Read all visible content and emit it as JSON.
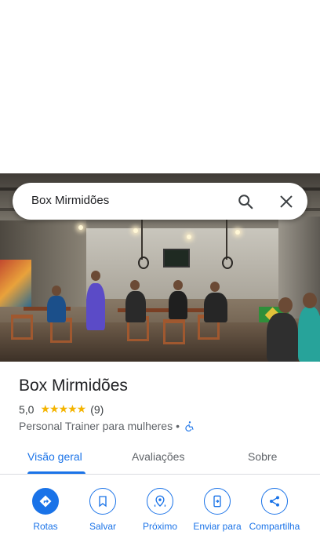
{
  "search": {
    "query": "Box Mirmidões"
  },
  "place": {
    "name": "Box Mirmidões",
    "rating": "5,0",
    "stars": "★★★★★",
    "review_count": "(9)",
    "category": "Personal Trainer para mulheres",
    "separator": "•"
  },
  "tabs": [
    {
      "label": "Visão geral",
      "active": true
    },
    {
      "label": "Avaliações",
      "active": false
    },
    {
      "label": "Sobre",
      "active": false
    }
  ],
  "actions": [
    {
      "label": "Rotas",
      "icon": "directions-icon"
    },
    {
      "label": "Salvar",
      "icon": "bookmark-icon"
    },
    {
      "label": "Próximo",
      "icon": "nearby-icon"
    },
    {
      "label": "Enviar para",
      "icon": "send-to-phone-icon"
    },
    {
      "label": "Compartilha",
      "icon": "share-icon"
    }
  ],
  "colors": {
    "accent": "#1a73e8",
    "star": "#f4b400",
    "text": "#202124",
    "muted": "#5f6368"
  }
}
